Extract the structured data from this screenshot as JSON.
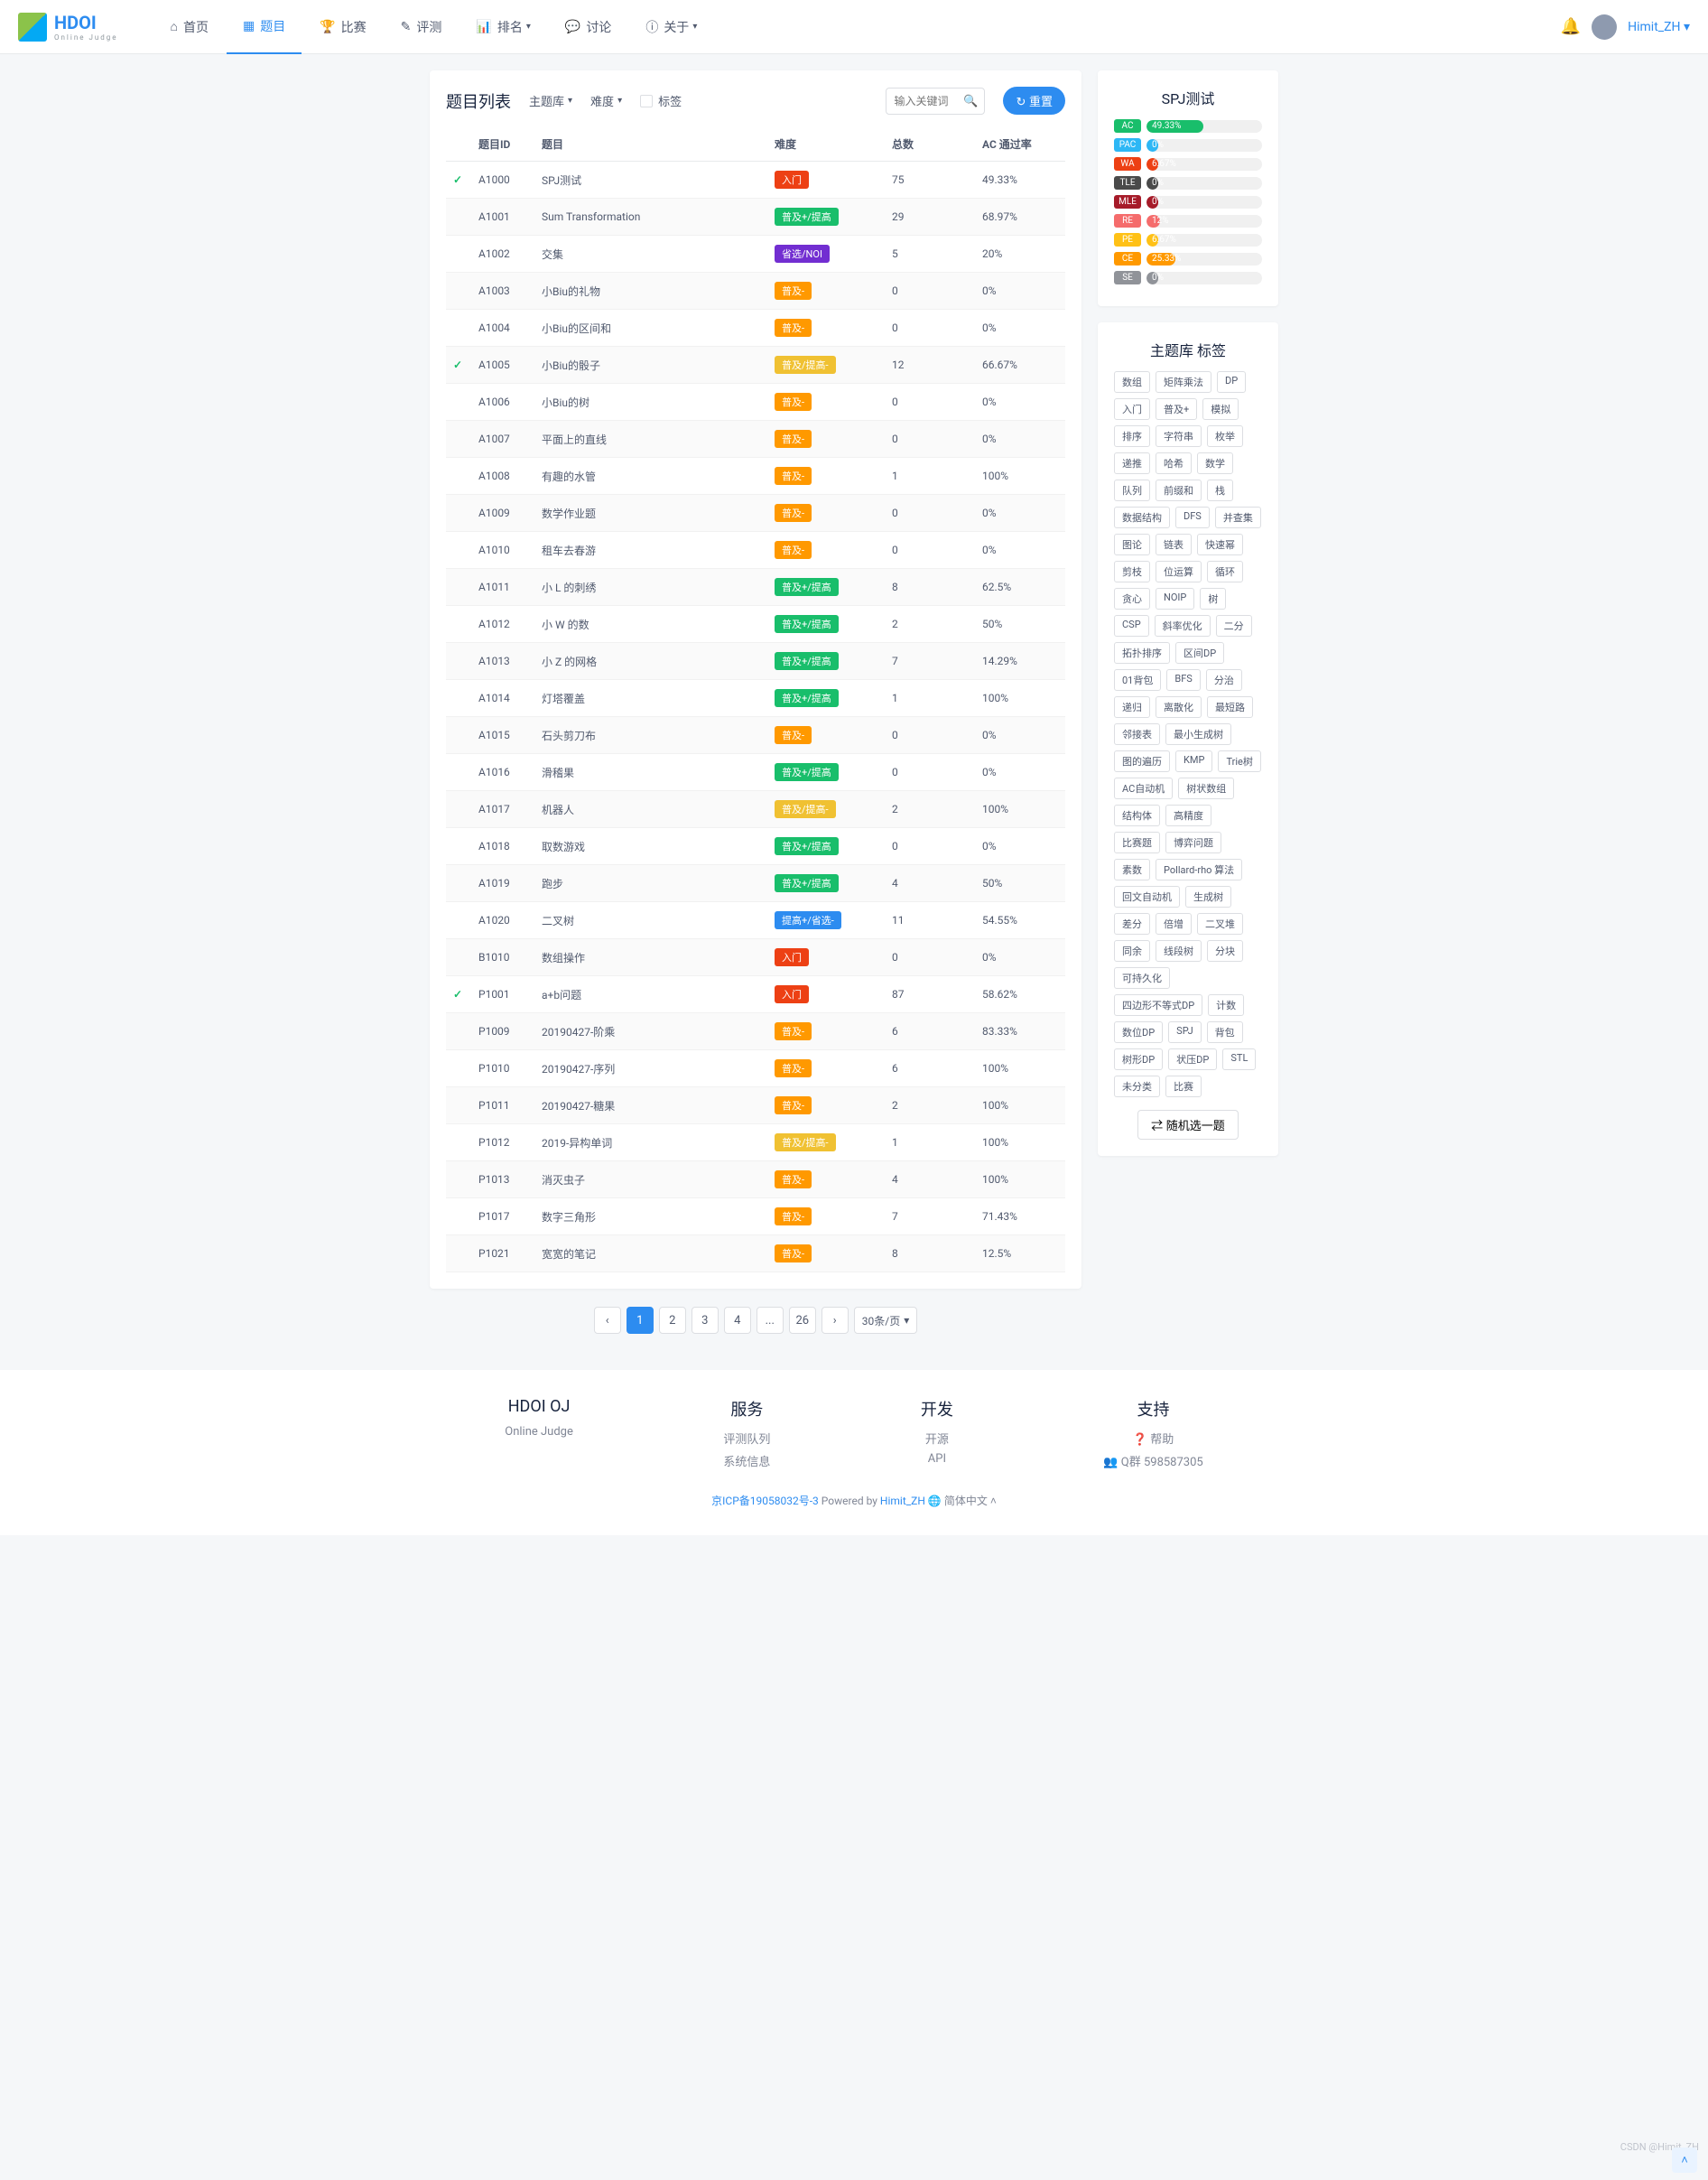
{
  "nav": {
    "logo": "HDOI",
    "logo_sub": "Online Judge",
    "items": [
      {
        "icon": "⌂",
        "label": "首页"
      },
      {
        "icon": "▦",
        "label": "题目",
        "active": true
      },
      {
        "icon": "🏆",
        "label": "比赛"
      },
      {
        "icon": "✎",
        "label": "评测"
      },
      {
        "icon": "📊",
        "label": "排名",
        "caret": true
      },
      {
        "icon": "💬",
        "label": "讨论"
      },
      {
        "icon": "ⓘ",
        "label": "关于",
        "caret": true
      }
    ],
    "username": "Himit_ZH"
  },
  "filters": {
    "title": "题目列表",
    "lib_label": "主题库",
    "diff_label": "难度",
    "tag_label": "标签",
    "search_placeholder": "输入关键词",
    "reset_label": "↻ 重置"
  },
  "columns": {
    "status": "",
    "id": "题目ID",
    "title": "题目",
    "diff": "难度",
    "total": "总数",
    "rate": "AC 通过率"
  },
  "diff_map": {
    "入门": "t-red",
    "普及+/提高": "t-green",
    "省选/NOI": "t-purple",
    "普及-": "t-orange",
    "普及/提高-": "t-yellow",
    "提高+/省选-": "t-blue"
  },
  "problems": [
    {
      "s": "✓",
      "id": "A1000",
      "t": "SPJ测试",
      "d": "入门",
      "n": "75",
      "r": "49.33%"
    },
    {
      "s": "",
      "id": "A1001",
      "t": "Sum Transformation",
      "d": "普及+/提高",
      "n": "29",
      "r": "68.97%"
    },
    {
      "s": "",
      "id": "A1002",
      "t": "交集",
      "d": "省选/NOI",
      "n": "5",
      "r": "20%"
    },
    {
      "s": "",
      "id": "A1003",
      "t": "小Biu的礼物",
      "d": "普及-",
      "n": "0",
      "r": "0%"
    },
    {
      "s": "",
      "id": "A1004",
      "t": "小Biu的区间和",
      "d": "普及-",
      "n": "0",
      "r": "0%"
    },
    {
      "s": "✓",
      "id": "A1005",
      "t": "小Biu的骰子",
      "d": "普及/提高-",
      "n": "12",
      "r": "66.67%"
    },
    {
      "s": "",
      "id": "A1006",
      "t": "小Biu的树",
      "d": "普及-",
      "n": "0",
      "r": "0%"
    },
    {
      "s": "",
      "id": "A1007",
      "t": "平面上的直线",
      "d": "普及-",
      "n": "0",
      "r": "0%"
    },
    {
      "s": "",
      "id": "A1008",
      "t": "有趣的水管",
      "d": "普及-",
      "n": "1",
      "r": "100%"
    },
    {
      "s": "",
      "id": "A1009",
      "t": "数学作业题",
      "d": "普及-",
      "n": "0",
      "r": "0%"
    },
    {
      "s": "",
      "id": "A1010",
      "t": "租车去春游",
      "d": "普及-",
      "n": "0",
      "r": "0%"
    },
    {
      "s": "",
      "id": "A1011",
      "t": "小 L 的刺绣",
      "d": "普及+/提高",
      "n": "8",
      "r": "62.5%"
    },
    {
      "s": "",
      "id": "A1012",
      "t": "小 W 的数",
      "d": "普及+/提高",
      "n": "2",
      "r": "50%"
    },
    {
      "s": "",
      "id": "A1013",
      "t": "小 Z 的网格",
      "d": "普及+/提高",
      "n": "7",
      "r": "14.29%"
    },
    {
      "s": "",
      "id": "A1014",
      "t": "灯塔覆盖",
      "d": "普及+/提高",
      "n": "1",
      "r": "100%"
    },
    {
      "s": "",
      "id": "A1015",
      "t": "石头剪刀布",
      "d": "普及-",
      "n": "0",
      "r": "0%"
    },
    {
      "s": "",
      "id": "A1016",
      "t": "滑稽果",
      "d": "普及+/提高",
      "n": "0",
      "r": "0%"
    },
    {
      "s": "",
      "id": "A1017",
      "t": "机器人",
      "d": "普及/提高-",
      "n": "2",
      "r": "100%"
    },
    {
      "s": "",
      "id": "A1018",
      "t": "取数游戏",
      "d": "普及+/提高",
      "n": "0",
      "r": "0%"
    },
    {
      "s": "",
      "id": "A1019",
      "t": "跑步",
      "d": "普及+/提高",
      "n": "4",
      "r": "50%"
    },
    {
      "s": "",
      "id": "A1020",
      "t": "二叉树",
      "d": "提高+/省选-",
      "n": "11",
      "r": "54.55%"
    },
    {
      "s": "",
      "id": "B1010",
      "t": "数组操作",
      "d": "入门",
      "n": "0",
      "r": "0%"
    },
    {
      "s": "✓",
      "id": "P1001",
      "t": "a+b问题",
      "d": "入门",
      "n": "87",
      "r": "58.62%"
    },
    {
      "s": "",
      "id": "P1009",
      "t": "20190427-阶乘",
      "d": "普及-",
      "n": "6",
      "r": "83.33%"
    },
    {
      "s": "",
      "id": "P1010",
      "t": "20190427-序列",
      "d": "普及-",
      "n": "6",
      "r": "100%"
    },
    {
      "s": "",
      "id": "P1011",
      "t": "20190427-糖果",
      "d": "普及-",
      "n": "2",
      "r": "100%"
    },
    {
      "s": "",
      "id": "P1012",
      "t": "2019-异构单词",
      "d": "普及/提高-",
      "n": "1",
      "r": "100%"
    },
    {
      "s": "",
      "id": "P1013",
      "t": "消灭虫子",
      "d": "普及-",
      "n": "4",
      "r": "100%"
    },
    {
      "s": "",
      "id": "P1017",
      "t": "数字三角形",
      "d": "普及-",
      "n": "7",
      "r": "71.43%"
    },
    {
      "s": "",
      "id": "P1021",
      "t": "宽宽的笔记",
      "d": "普及-",
      "n": "8",
      "r": "12.5%"
    }
  ],
  "pagination": {
    "pages": [
      "1",
      "2",
      "3",
      "4",
      "...",
      "26"
    ],
    "active": "1",
    "size": "30条/页"
  },
  "spj": {
    "title": "SPJ测试",
    "rows": [
      {
        "k": "AC",
        "c": "b-ac",
        "v": "49.33%",
        "w": 49.33
      },
      {
        "k": "PAC",
        "c": "b-pac",
        "v": "0%",
        "w": 0
      },
      {
        "k": "WA",
        "c": "b-wa",
        "v": "6.67%",
        "w": 6.67
      },
      {
        "k": "TLE",
        "c": "b-tle",
        "v": "0%",
        "w": 0
      },
      {
        "k": "MLE",
        "c": "b-mle",
        "v": "0%",
        "w": 0
      },
      {
        "k": "RE",
        "c": "b-re",
        "v": "12%",
        "w": 12
      },
      {
        "k": "PE",
        "c": "b-pe",
        "v": "6.67%",
        "w": 6.67
      },
      {
        "k": "CE",
        "c": "b-ce",
        "v": "25.33%",
        "w": 25.33
      },
      {
        "k": "SE",
        "c": "b-se",
        "v": "0%",
        "w": 0
      }
    ]
  },
  "tagbox": {
    "title": "主题库 标签",
    "tags": [
      "数组",
      "矩阵乘法",
      "DP",
      "入门",
      "普及+",
      "模拟",
      "排序",
      "字符串",
      "枚举",
      "递推",
      "哈希",
      "数学",
      "队列",
      "前缀和",
      "栈",
      "数据结构",
      "DFS",
      "并查集",
      "图论",
      "链表",
      "快速幂",
      "剪枝",
      "位运算",
      "循环",
      "贪心",
      "NOIP",
      "树",
      "CSP",
      "斜率优化",
      "二分",
      "拓扑排序",
      "区间DP",
      "01背包",
      "BFS",
      "分治",
      "递归",
      "离散化",
      "最短路",
      "邻接表",
      "最小生成树",
      "图的遍历",
      "KMP",
      "Trie树",
      "AC自动机",
      "树状数组",
      "结构体",
      "高精度",
      "比赛题",
      "博弈问题",
      "素数",
      "Pollard-rho 算法",
      "回文自动机",
      "生成树",
      "差分",
      "倍增",
      "二叉堆",
      "同余",
      "线段树",
      "分块",
      "可持久化",
      "四边形不等式DP",
      "计数",
      "数位DP",
      "SPJ",
      "背包",
      "树形DP",
      "状压DP",
      "STL",
      "未分类",
      "比赛"
    ],
    "random": "随机选一题"
  },
  "footer": {
    "cols": [
      {
        "h": "HDOI OJ",
        "items": [
          "Online Judge"
        ]
      },
      {
        "h": "服务",
        "items": [
          "评测队列",
          "系统信息"
        ]
      },
      {
        "h": "开发",
        "items": [
          "开源",
          "API"
        ]
      },
      {
        "h": "支持",
        "items": [
          "❓ 帮助",
          "👥 Q群 598587305"
        ]
      }
    ],
    "icp": "京ICP备19058032号-3",
    "powered": "Powered by",
    "author": "Himit_ZH",
    "lang": "简体中文"
  },
  "watermark": "CSDN @Himit_ZH"
}
